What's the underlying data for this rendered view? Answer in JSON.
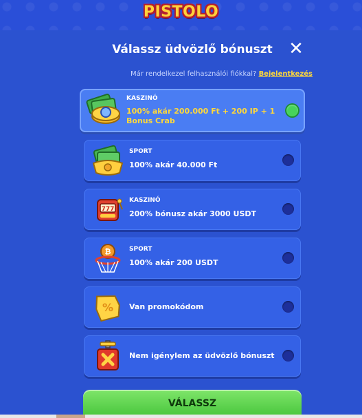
{
  "header": {
    "logo_text": "PISTOLO"
  },
  "dialog": {
    "title": "Válassz üdvözlő bónuszt",
    "login_question": "Már rendelkezel felhasználói fiókkal?",
    "login_link": "Bejelentkezés",
    "submit_label": "VÁLASSZ"
  },
  "options": [
    {
      "category": "KASZINÓ",
      "text": "100% akár 200.000 Ft + 200 IP + 1 Bonus Crab",
      "selected": true,
      "icon": "cash-coin-icon"
    },
    {
      "category": "SPORT",
      "text": "100% akár 40.000 Ft",
      "selected": false,
      "icon": "cash-bag-icon"
    },
    {
      "category": "KASZINÓ",
      "text": "200% bónusz akár 3000 USDT",
      "selected": false,
      "icon": "slot-machine-icon"
    },
    {
      "category": "SPORT",
      "text": "100% akár 200 USDT",
      "selected": false,
      "icon": "bitcoin-basketball-icon"
    },
    {
      "category": "",
      "text": "Van promokódom",
      "selected": false,
      "icon": "percent-ticket-icon"
    },
    {
      "category": "",
      "text": "Nem igénylem az üdvözlő bónuszt",
      "selected": false,
      "icon": "no-bonus-box-icon"
    }
  ],
  "colors": {
    "background": "#2f52d6",
    "card": "#3461e6",
    "card_selected": "#4a7df3",
    "highlight_text": "#ffd83a",
    "radio_on": "#46d35b",
    "button": "#45c43a"
  }
}
